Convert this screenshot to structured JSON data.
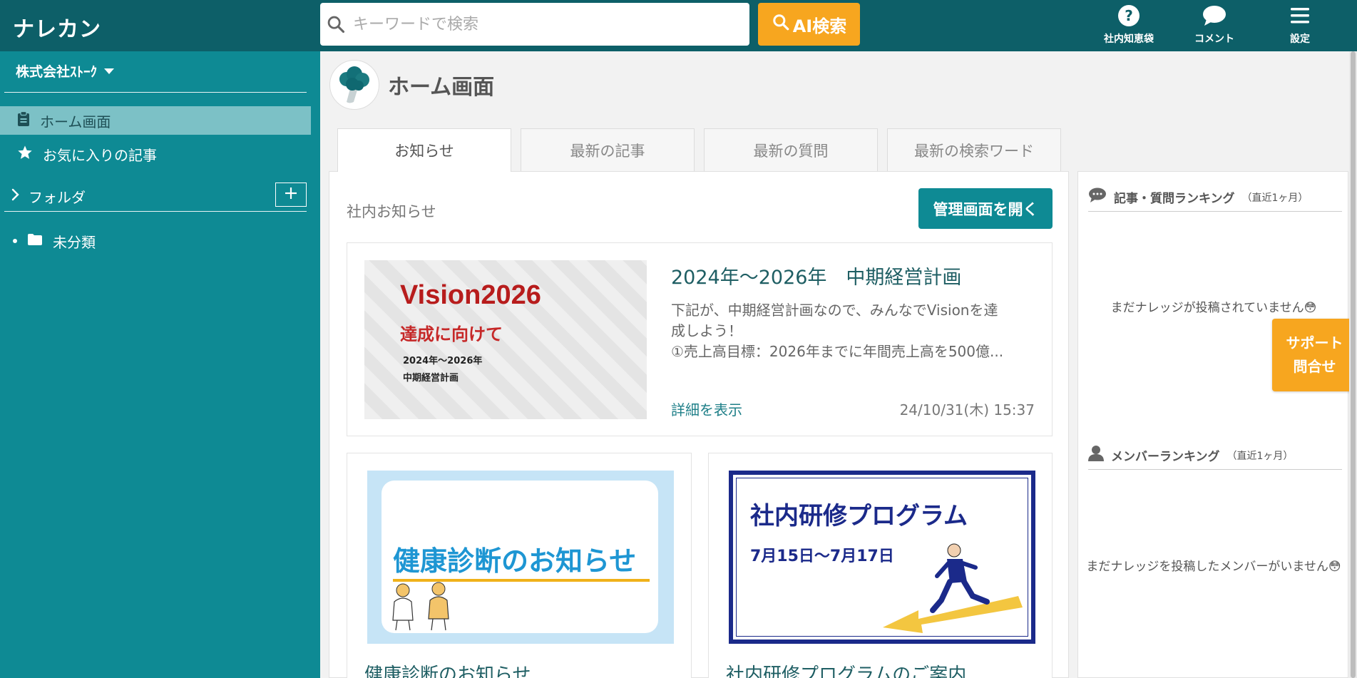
{
  "header": {
    "logo": "ナレカン",
    "search_placeholder": "キーワードで検索",
    "ai_search_label": "AI検索",
    "nav": [
      {
        "label": "社内知恵袋",
        "icon": "question-circle-icon"
      },
      {
        "label": "コメント",
        "icon": "comment-icon"
      },
      {
        "label": "設定",
        "icon": "menu-icon"
      }
    ]
  },
  "sidebar": {
    "company": "株式会社ｽﾄｰｸ",
    "items": [
      {
        "label": "ホーム画面",
        "icon": "clipboard-icon",
        "active": true
      },
      {
        "label": "お気に入りの記事",
        "icon": "star-icon",
        "active": false
      }
    ],
    "folder_label": "フォルダ",
    "folders": [
      {
        "label": "未分類",
        "icon": "folder-icon"
      }
    ]
  },
  "main": {
    "title": "ホーム画面",
    "tabs": [
      "お知らせ",
      "最新の記事",
      "最新の質問",
      "最新の検索ワード"
    ],
    "active_tab": 0,
    "section_title": "社内お知らせ",
    "admin_button": "管理画面を開く",
    "featured": {
      "thumb_title": "Vision2026",
      "thumb_subtitle": "達成に向けて",
      "thumb_line1": "2024年〜2026年",
      "thumb_line2": "中期経営計画",
      "title": "2024年〜2026年　中期経営計画",
      "excerpt_lines": [
        "下記が、中期経営計画なので、みんなでVisionを達",
        "成しよう！",
        "①売上高目標：2026年までに年間売上高を500億..."
      ],
      "detail_link": "詳細を表示",
      "date": "24/10/31(木) 15:37"
    },
    "cards": [
      {
        "thumb_text": "健康診断のお知らせ",
        "title": "健康診断のお知らせ"
      },
      {
        "thumb_text": "社内研修プログラム",
        "thumb_sub": "7月15日〜7月17日",
        "title": "社内研修プログラムのご案内"
      }
    ]
  },
  "right": {
    "ranking1": {
      "title": "記事・質問ランキング",
      "sub": "（直近1ヶ月）",
      "empty": "まだナレッジが投稿されていません😳"
    },
    "ranking2": {
      "title": "メンバーランキング",
      "sub": "（直近1ヶ月）",
      "empty": "まだナレッジを投稿したメンバーがいません😳"
    }
  },
  "support": {
    "line1": "サポート",
    "line2": "問合せ"
  },
  "colors": {
    "header": "#0d5f68",
    "sidebar": "#0e8a94",
    "accent": "#f7a61f",
    "link": "#1e7f88"
  }
}
